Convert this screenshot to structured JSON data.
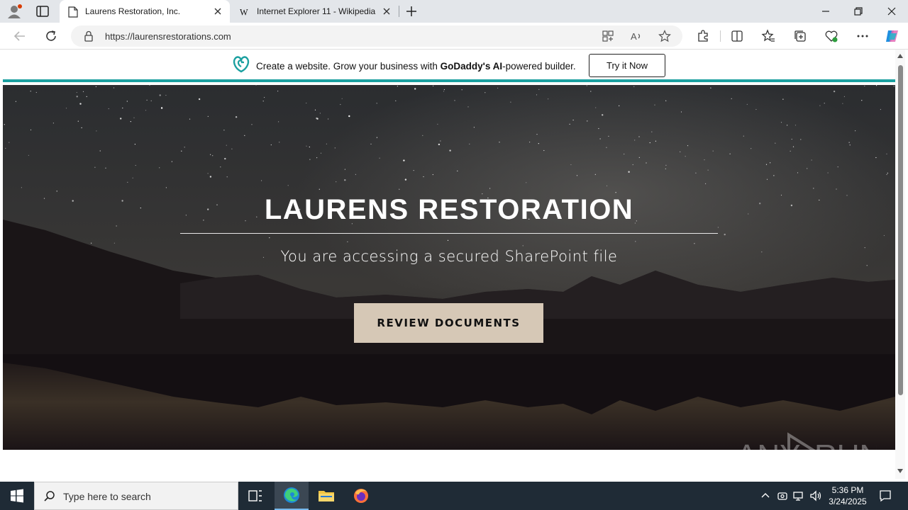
{
  "browser": {
    "tabs": [
      {
        "title": "Laurens Restoration, Inc.",
        "active": true
      },
      {
        "title": "Internet Explorer 11 - Wikipedia",
        "active": false
      }
    ],
    "url": "https://laurensrestorations.com"
  },
  "promo": {
    "text_before": "Create a website. Grow your business with ",
    "brand": "GoDaddy's",
    "text_ai": " AI",
    "text_after": "-powered builder.",
    "cta": "Try it Now"
  },
  "hero": {
    "title": "LAURENS RESTORATION",
    "subtitle": "You are accessing a secured SharePoint file",
    "button": "REVIEW DOCUMENTS"
  },
  "watermark": "ANY RUN",
  "taskbar": {
    "search_placeholder": "Type here to search",
    "time": "5:36 PM",
    "date": "3/24/2025"
  },
  "colors": {
    "accent_teal": "#1ba0a0",
    "button_beige": "#d6c8b6",
    "taskbar": "#1f2b36"
  }
}
